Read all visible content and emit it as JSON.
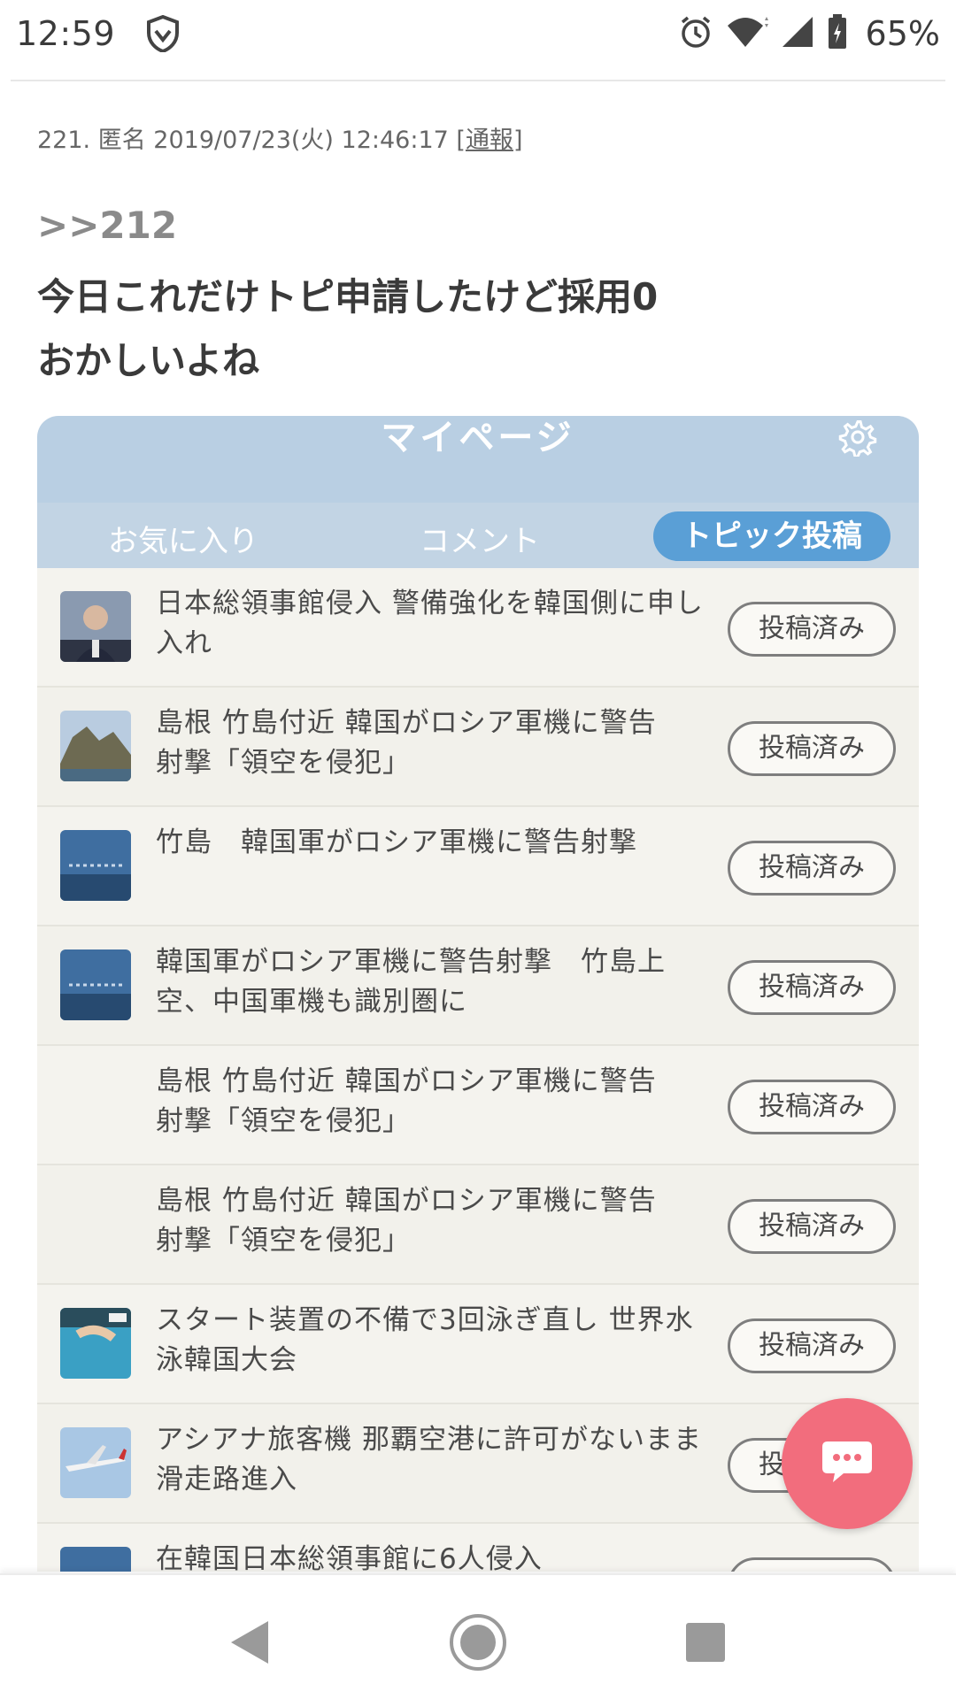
{
  "status_bar": {
    "time": "12:59",
    "battery_percent": "65%",
    "icons": [
      "shield-icon",
      "alarm-icon",
      "wifi-icon",
      "signal-icon",
      "battery-icon"
    ]
  },
  "post": {
    "meta_prefix": "221. 匿名 2019/07/23(火) 12:46:17 [",
    "report_link": "通報",
    "meta_suffix": "]",
    "reply_ref": ">>212",
    "body_line1": "今日これだけトピ申請したけど採用0",
    "body_line2": "おかしいよね"
  },
  "embedded_screenshot": {
    "title": "マイページ",
    "tabs": [
      "お気に入り",
      "コメント",
      "トピック投稿"
    ],
    "active_tab": "トピック投稿",
    "topics": [
      {
        "line1": "日本総領事館侵入 警備強化を韓国側に申し",
        "line2": "入れ",
        "badge": "投稿済み",
        "thumb": "person"
      },
      {
        "line1": "島根 竹島付近 韓国がロシア軍機に警告",
        "line2": "射撃「領空を侵犯」",
        "badge": "投稿済み",
        "thumb": "island"
      },
      {
        "line1": "竹島　韓国軍がロシア軍機に警告射撃",
        "line2": "",
        "badge": "投稿済み",
        "thumb": "sea"
      },
      {
        "line1": "韓国軍がロシア軍機に警告射撃　竹島上",
        "line2": "空、中国軍機も識別圏に",
        "badge": "投稿済み",
        "thumb": "sea"
      },
      {
        "line1": "島根 竹島付近 韓国がロシア軍機に警告",
        "line2": "射撃「領空を侵犯」",
        "badge": "投稿済み",
        "thumb": "none"
      },
      {
        "line1": "島根 竹島付近 韓国がロシア軍機に警告",
        "line2": "射撃「領空を侵犯」",
        "badge": "投稿済み",
        "thumb": "none"
      },
      {
        "line1": "スタート装置の不備で3回泳ぎ直し 世界水",
        "line2": "泳韓国大会",
        "badge": "投稿済み",
        "thumb": "swim"
      },
      {
        "line1": "アシアナ旅客機 那覇空港に許可がないまま",
        "line2": "滑走路進入",
        "badge": "投稿済み",
        "thumb": "plane"
      },
      {
        "line1": "在韓国日本総領事館に6人侵入",
        "line2": "",
        "badge": "",
        "thumb": "sea"
      }
    ]
  },
  "fab": {
    "icon": "chat-bubble-icon",
    "color": "#f26d7d"
  },
  "nav_bar": {
    "buttons": [
      "back-icon",
      "home-icon",
      "recents-icon"
    ]
  }
}
